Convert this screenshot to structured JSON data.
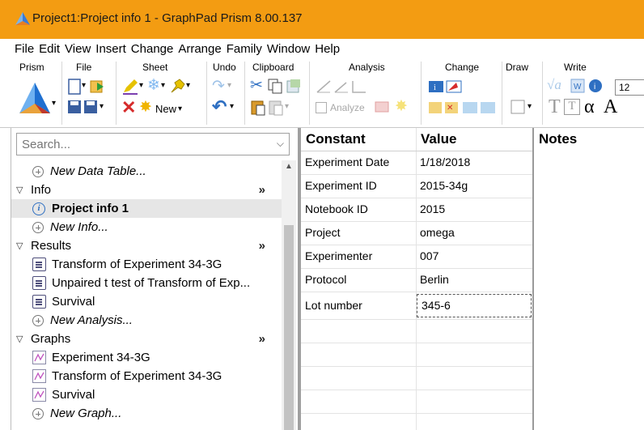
{
  "window": {
    "title": "Project1:Project info 1 - GraphPad Prism 8.00.137",
    "accent_color": "#f39c12"
  },
  "menu": [
    "File",
    "Edit",
    "View",
    "Insert",
    "Change",
    "Arrange",
    "Family",
    "Window",
    "Help"
  ],
  "ribbon": {
    "groups": [
      "Prism",
      "File",
      "Sheet",
      "Undo",
      "Clipboard",
      "Analysis",
      "Change",
      "Draw",
      "Write"
    ],
    "new_label": "New",
    "analyze_label": "Analyze",
    "font_size_value": "12",
    "write_glyphs": [
      "α",
      "A"
    ]
  },
  "navigator": {
    "search_placeholder": "Search...",
    "items": [
      {
        "type": "new",
        "label": "New Data Table..."
      },
      {
        "type": "section",
        "label": "Info",
        "more": "»"
      },
      {
        "type": "info",
        "label": "Project info 1",
        "selected": true
      },
      {
        "type": "new",
        "label": "New Info..."
      },
      {
        "type": "section",
        "label": "Results",
        "more": "»"
      },
      {
        "type": "result",
        "label": "Transform of Experiment 34-3G"
      },
      {
        "type": "result",
        "label": "Unpaired t test of Transform of Exp..."
      },
      {
        "type": "result",
        "label": "Survival"
      },
      {
        "type": "new",
        "label": "New Analysis..."
      },
      {
        "type": "section",
        "label": "Graphs",
        "more": "»"
      },
      {
        "type": "graph",
        "label": "Experiment 34-3G"
      },
      {
        "type": "graph",
        "label": "Transform of Experiment 34-3G"
      },
      {
        "type": "graph",
        "label": "Survival"
      },
      {
        "type": "new",
        "label": "New Graph..."
      }
    ]
  },
  "info_sheet": {
    "col_constant": "Constant",
    "col_value": "Value",
    "rows": [
      {
        "constant": "Experiment Date",
        "value": "1/18/2018"
      },
      {
        "constant": "Experiment ID",
        "value": "2015-34g"
      },
      {
        "constant": "Notebook ID",
        "value": "2015"
      },
      {
        "constant": "Project",
        "value": "omega"
      },
      {
        "constant": "Experimenter",
        "value": "007"
      },
      {
        "constant": "Protocol",
        "value": "Berlin"
      },
      {
        "constant": "Lot number",
        "value": "345-6",
        "editing": true
      }
    ]
  },
  "notes": {
    "header": "Notes"
  }
}
